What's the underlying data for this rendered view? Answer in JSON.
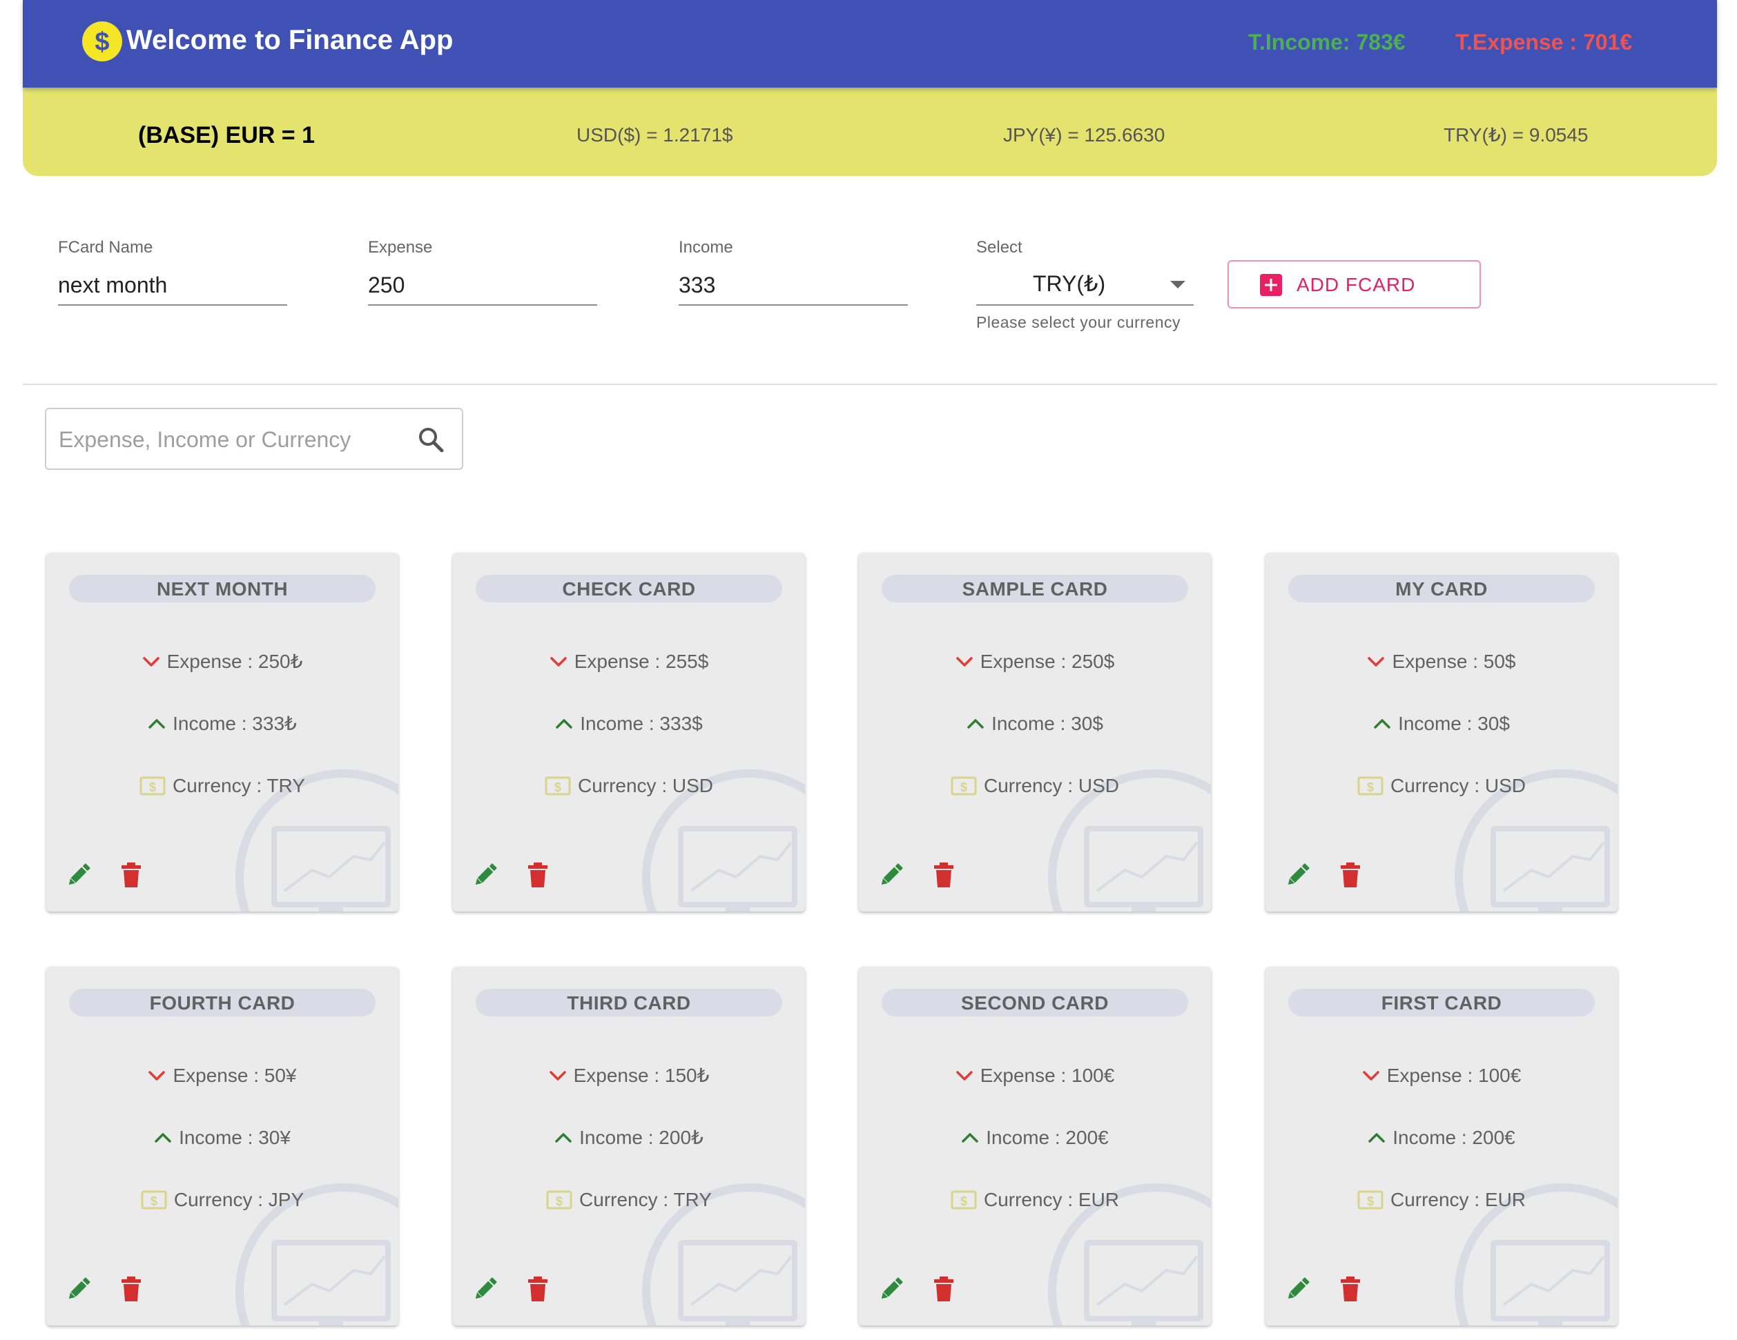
{
  "header": {
    "title": "Welcome to Finance App",
    "total_income": "T.Income: 783€",
    "total_expense": "T.Expense : 701€"
  },
  "rates": {
    "base": "(BASE) EUR = 1",
    "usd": "USD($) = 1.2171$",
    "jpy": "JPY(¥) = 125.6630",
    "try": "TRY(₺) = 9.0545"
  },
  "form": {
    "name_label": "FCard Name",
    "name_value": "next month",
    "expense_label": "Expense",
    "expense_value": "250",
    "income_label": "Income",
    "income_value": "333",
    "select_label": "Select",
    "select_value": "TRY(₺)",
    "select_helper": "Please select your currency",
    "add_button": "ADD FCARD"
  },
  "search": {
    "placeholder": "Expense, Income or Currency"
  },
  "cards": [
    {
      "title": "NEXT MONTH",
      "expense": "Expense : 250₺",
      "income": "Income : 333₺",
      "currency": "Currency : TRY"
    },
    {
      "title": "CHECK CARD",
      "expense": "Expense : 255$",
      "income": "Income : 333$",
      "currency": "Currency : USD"
    },
    {
      "title": "SAMPLE CARD",
      "expense": "Expense : 250$",
      "income": "Income : 30$",
      "currency": "Currency : USD"
    },
    {
      "title": "MY CARD",
      "expense": "Expense : 50$",
      "income": "Income : 30$",
      "currency": "Currency : USD"
    },
    {
      "title": "FOURTH CARD",
      "expense": "Expense : 50¥",
      "income": "Income : 30¥",
      "currency": "Currency : JPY"
    },
    {
      "title": "THIRD CARD",
      "expense": "Expense : 150₺",
      "income": "Income : 200₺",
      "currency": "Currency : TRY"
    },
    {
      "title": "SECOND CARD",
      "expense": "Expense : 100€",
      "income": "Income : 200€",
      "currency": "Currency : EUR"
    },
    {
      "title": "FIRST CARD",
      "expense": "Expense : 100€",
      "income": "Income : 200€",
      "currency": "Currency : EUR"
    }
  ],
  "icons": {
    "logo": "dollar-coin-icon",
    "add": "plus-box-icon",
    "search": "search-icon",
    "expense": "chevron-down-icon",
    "income": "chevron-up-icon",
    "currency": "cash-icon",
    "edit": "pencil-icon",
    "delete": "trash-icon",
    "card_background": "monitor-chart-icon"
  },
  "colors": {
    "header": "#3f51b5",
    "rates_bar": "#e3e36e",
    "income": "#4caf50",
    "expense": "#ef5350",
    "accent": "#e91e63",
    "edit": "#2e8b3e",
    "delete": "#d32f2f",
    "card": "#ebebeb"
  }
}
